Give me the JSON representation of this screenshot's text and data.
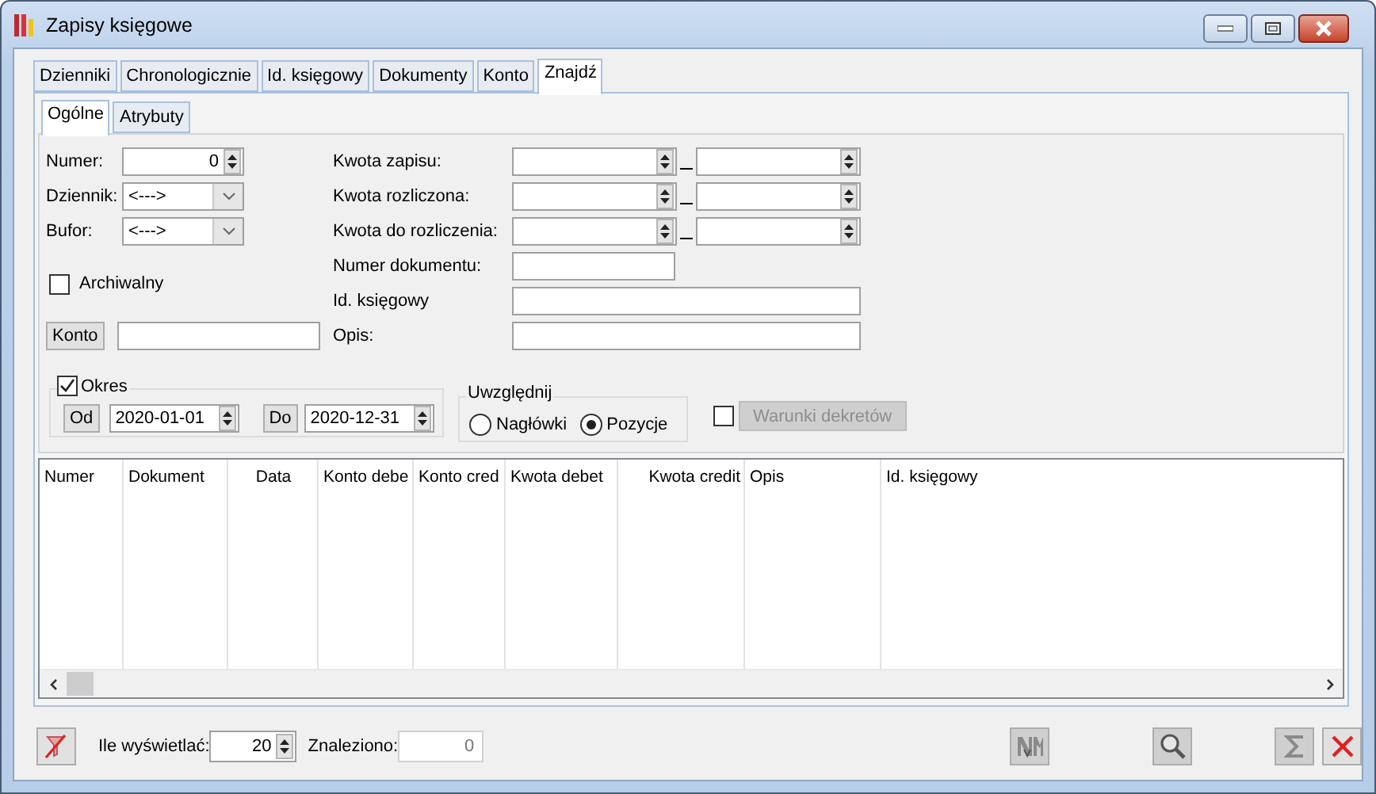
{
  "window": {
    "title": "Zapisy księgowe"
  },
  "tabs": [
    {
      "label": "Dzienniki",
      "selected": false
    },
    {
      "label": "Chronologicznie",
      "selected": false
    },
    {
      "label": "Id. księgowy",
      "selected": false
    },
    {
      "label": "Dokumenty",
      "selected": false
    },
    {
      "label": "Konto",
      "selected": false
    },
    {
      "label": "Znajdź",
      "selected": true
    }
  ],
  "subtabs": [
    {
      "label": "Ogólne",
      "selected": true
    },
    {
      "label": "Atrybuty",
      "selected": false
    }
  ],
  "filters": {
    "numer": {
      "label": "Numer:",
      "value": "0"
    },
    "dziennik": {
      "label": "Dziennik:",
      "value": "<--->"
    },
    "bufor": {
      "label": "Bufor:",
      "value": "<--->"
    },
    "archiwalny": {
      "label": "Archiwalny",
      "checked": false
    },
    "konto": {
      "button": "Konto"
    }
  },
  "amounts": [
    {
      "label": "Kwota zapisu:"
    },
    {
      "label": "Kwota rozliczona:"
    },
    {
      "label": "Kwota do rozliczenia:"
    }
  ],
  "text_fields": [
    {
      "label": "Numer dokumentu:",
      "kind": "short"
    },
    {
      "label": "Id. księgowy",
      "kind": "wide"
    },
    {
      "label": "Opis:",
      "kind": "wide"
    }
  ],
  "period": {
    "label": "Okres",
    "checked": true,
    "from_button": "Od",
    "from": "2020-01-01",
    "to_button": "Do",
    "to": "2020-12-31"
  },
  "include": {
    "label": "Uwzględnij",
    "options": [
      {
        "label": "Nagłówki",
        "selected": false
      },
      {
        "label": "Pozycje",
        "selected": true
      }
    ]
  },
  "conditions": {
    "checked": false,
    "button": "Warunki dekretów",
    "disabled": true
  },
  "table": {
    "columns": [
      "Numer",
      "Dokument",
      "Data",
      "Konto debe",
      "Konto cred",
      "Kwota debet",
      "Kwota credit",
      "Opis",
      "Id. księgowy"
    ]
  },
  "footer": {
    "show_label": "Ile wyświetlać:",
    "show_value": "20",
    "found_label": "Znaleziono:",
    "found_value": "0"
  }
}
